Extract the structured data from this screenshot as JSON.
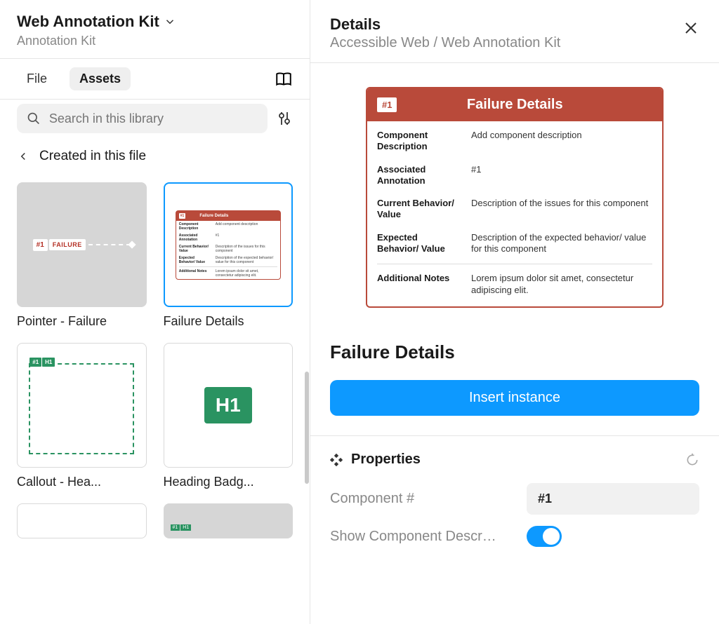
{
  "left": {
    "title": "Web Annotation Kit",
    "subtitle": "Annotation Kit",
    "tabs": {
      "file": "File",
      "assets": "Assets"
    },
    "search_placeholder": "Search in this library",
    "section_title": "Created in this file",
    "assets": [
      {
        "label": "Pointer - Failure",
        "thumb": {
          "num": "#1",
          "tag": "FAILURE"
        }
      },
      {
        "label": "Failure Details"
      },
      {
        "label": "Callout - Hea...",
        "thumb": {
          "num": "#1",
          "tag": "H1"
        }
      },
      {
        "label": "Heading Badg...",
        "thumb": {
          "tag": "H1"
        }
      }
    ]
  },
  "right": {
    "title": "Details",
    "breadcrumb": "Accessible Web / Web Annotation Kit",
    "preview": {
      "num": "#1",
      "title": "Failure Details",
      "rows": [
        {
          "key": "Component Description",
          "value": "Add component description"
        },
        {
          "key": "Associated Annotation",
          "value": "#1"
        },
        {
          "key": "Current Behavior/ Value",
          "value": "Description of the issues for this component"
        },
        {
          "key": "Expected Behavior/ Value",
          "value": "Description of the expected behavior/ value for this component"
        }
      ],
      "additional": {
        "key": "Additional Notes",
        "value": "Lorem ipsum dolor sit amet, consectetur adipiscing elit."
      }
    },
    "component_name": "Failure Details",
    "insert_button": "Insert instance",
    "properties": {
      "title": "Properties",
      "component_num_label": "Component #",
      "component_num_value": "#1",
      "show_desc_label": "Show Component Descr…"
    }
  }
}
